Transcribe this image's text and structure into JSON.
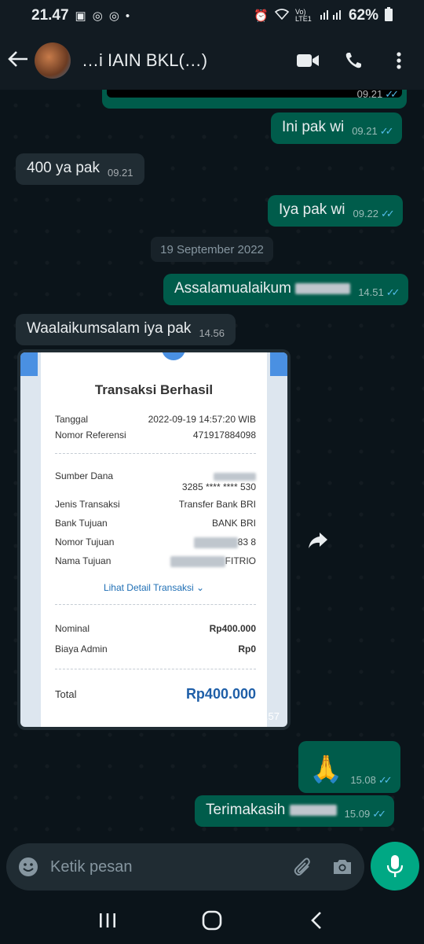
{
  "status_bar": {
    "time": "21.47",
    "battery": "62%",
    "network": "Vo) LTE1"
  },
  "header": {
    "title": "…i IAIN BKL(…)",
    "icons": [
      "back-arrow-icon",
      "video-call-icon",
      "phone-icon",
      "more-vert-icon"
    ]
  },
  "messages": [
    {
      "dir": "out",
      "text": "",
      "time": "09.21",
      "kind": "image"
    },
    {
      "dir": "out",
      "text": "Ini pak wi",
      "time": "09.21"
    },
    {
      "dir": "in",
      "text": "400 ya pak",
      "time": "09.21"
    },
    {
      "dir": "out",
      "text": "Iya pak wi",
      "time": "09.22"
    },
    {
      "dir": "out",
      "text": "Assalamualaikum",
      "time": "14.51"
    },
    {
      "dir": "in",
      "text": "Waalaikumsalam iya pak",
      "time": "14.56"
    },
    {
      "dir": "out",
      "text": "🙏",
      "time": "15.08"
    },
    {
      "dir": "out",
      "text": "Terimakasih",
      "time": "15.09"
    }
  ],
  "date_chip": "19 September 2022",
  "receipt": {
    "title": "Transaksi Berhasil",
    "rows": [
      {
        "label": "Tanggal",
        "value": "2022-09-19 14:57:20 WIB"
      },
      {
        "label": "Nomor Referensi",
        "value": "471917884098"
      },
      {
        "label": "Sumber Dana",
        "value": "3285 **** **** 530"
      },
      {
        "label": "Jenis Transaksi",
        "value": "Transfer Bank BRI"
      },
      {
        "label": "Bank Tujuan",
        "value": "BANK BRI"
      },
      {
        "label": "Nomor Tujuan",
        "value": "83 8"
      },
      {
        "label": "Nama Tujuan",
        "value": "FITRIO"
      }
    ],
    "link": "Lihat Detail Transaksi ⌄",
    "nominal_label": "Nominal",
    "nominal_value": "Rp400.000",
    "admin_label": "Biaya Admin",
    "admin_value": "Rp0",
    "total_label": "Total",
    "total_value": "Rp400.000",
    "time": "14.57"
  },
  "composer": {
    "placeholder": "Ketik pesan"
  },
  "colors": {
    "outgoing": "#005c4b",
    "incoming": "#202c33",
    "accent": "#00a884",
    "read_ticks": "#53bdeb"
  }
}
